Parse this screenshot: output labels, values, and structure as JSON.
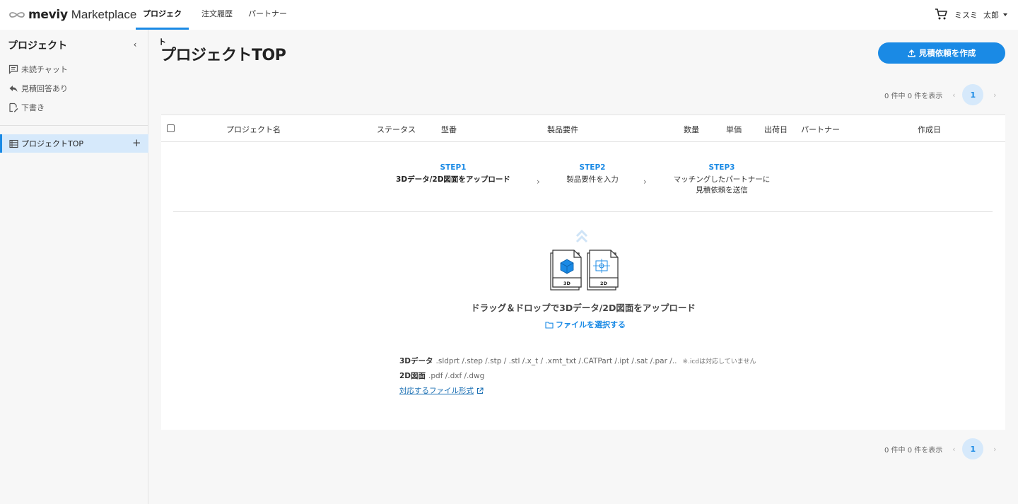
{
  "brand": {
    "name_bold": "meviy",
    "name_light": "Marketplace"
  },
  "nav": {
    "tabs": [
      {
        "label": "プロジェクト"
      },
      {
        "label": "注文履歴"
      },
      {
        "label": "パートナー"
      }
    ]
  },
  "user": {
    "company": "ミスミ",
    "name": "太郎"
  },
  "sidebar": {
    "title": "プロジェクト",
    "collapse_glyph": "‹",
    "items": [
      {
        "label": "未読チャット"
      },
      {
        "label": "見積回答あり"
      },
      {
        "label": "下書き"
      }
    ],
    "active": {
      "label": "プロジェクトTOP",
      "add_glyph": "+"
    }
  },
  "main": {
    "title": "プロジェクトTOP",
    "create_button": "見積依頼を作成",
    "pager": {
      "count": "0 件中 0 件を表示",
      "page": "1",
      "prev": "‹",
      "next": "›"
    },
    "table": {
      "headers": [
        "プロジェクト名",
        "ステータス",
        "型番",
        "製品要件",
        "数量",
        "単価",
        "出荷日",
        "パートナー",
        "作成日"
      ]
    },
    "steps": [
      {
        "label": "STEP1",
        "desc": "3Dデータ/2D図面をアップロード"
      },
      {
        "label": "STEP2",
        "desc": "製品要件を入力"
      },
      {
        "label": "STEP3",
        "desc_line1": "マッチングしたパートナーに",
        "desc_line2": "見積依頼を送信"
      }
    ],
    "step_arrow": "›",
    "dropzone": {
      "badge_3d": "3D",
      "badge_2d": "2D",
      "text": "ドラッグ＆ドロップで3Dデータ/2D図面をアップロード",
      "select_link": "ファイルを選択する"
    },
    "formats": {
      "data3d_key": "3Dデータ",
      "data3d_values": ".sldprt /.step /.stp / .stl /.x_t / .xmt_txt /.CATPart /.ipt /.sat /.par /..",
      "data3d_note": "※.icdは対応していません",
      "drawing2d_key": "2D図面",
      "drawing2d_values": ".pdf /.dxf /.dwg",
      "link": "対応するファイル形式"
    }
  },
  "colors": {
    "accent": "#1a8ae5",
    "active_bg": "#d6e9fb"
  }
}
